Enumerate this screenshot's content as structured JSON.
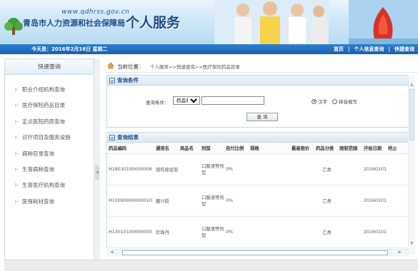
{
  "header": {
    "url_text": "www.qdhrss.gov.cn",
    "org_name": "青岛市人力资源和社会保障局",
    "service_title": "个人服务"
  },
  "navbar": {
    "date_text": "今天是：2016年2月16日 星期二",
    "links": [
      "首页",
      "|",
      "个人信息查询",
      "|",
      "快捷查询"
    ]
  },
  "sidebar": {
    "title": "快速查询",
    "items": [
      {
        "label": "职业介绍机构查询"
      },
      {
        "label": "医疗保险药品目录"
      },
      {
        "label": "定点医院药房查询"
      },
      {
        "label": "诊疗项目及服务设施"
      },
      {
        "label": "病种目录查询"
      },
      {
        "label": "生育病种查询"
      },
      {
        "label": "生育医疗机构查询"
      },
      {
        "label": "医保耗材查询"
      }
    ]
  },
  "location": {
    "label": "当前位置：",
    "breadcrumb": "个人服务>>快速查询>>医疗保险药品目录"
  },
  "query": {
    "title": "查询条件",
    "field_label": "查询条件：",
    "select_value": "药品名",
    "keyword_value": "",
    "radio_options": [
      {
        "label": "汉字",
        "checked": true
      },
      {
        "label": "拼音缩写",
        "checked": false
      }
    ],
    "button_label": "查 询"
  },
  "results": {
    "title": "查询结果",
    "columns": [
      "药品编码",
      "通用名",
      "商品名",
      "剂型",
      "自付比例",
      "规格",
      "最高限价",
      "药品分类",
      "限制范围",
      "开始日期",
      "终止"
    ],
    "rows": [
      {
        "code": "H18030100000006",
        "generic": "烧伤除皿软",
        "trade": "",
        "form": "口服液等剂型",
        "ratio": "0%",
        "spec": "",
        "max": "",
        "class": "乙类",
        "limit": "",
        "start": "20160101",
        "end": ""
      },
      {
        "code": "H10090000000010",
        "generic": "醒沙胶",
        "trade": "",
        "form": "口服液等剂型",
        "ratio": "0%",
        "spec": "",
        "max": "",
        "class": "乙类",
        "limit": "",
        "start": "20160101",
        "end": ""
      },
      {
        "code": "H13010100000005",
        "generic": "珍珠丹",
        "trade": "",
        "form": "口服液等剂型",
        "ratio": "0%",
        "spec": "",
        "max": "",
        "class": "乙类",
        "limit": "",
        "start": "20160101",
        "end": ""
      }
    ]
  },
  "colors": {
    "nav_blue": "#1a61b2",
    "panel_title": "#1d4e86",
    "border": "#c7d6e4"
  }
}
